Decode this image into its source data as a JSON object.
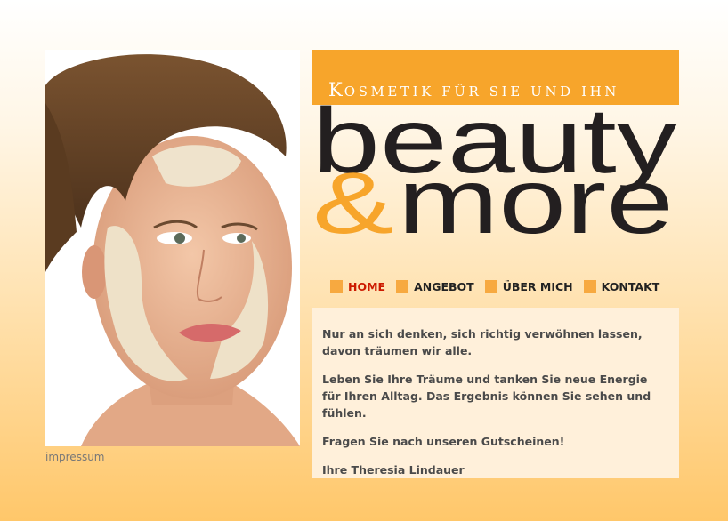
{
  "tagline": {
    "first_letter": "K",
    "rest": "OSMETIK FÜR SIE UND IHN"
  },
  "logo": {
    "line1": "beauty",
    "ampersand": "&",
    "line2": "more"
  },
  "nav": {
    "items": [
      {
        "label": "HOME",
        "active": true
      },
      {
        "label": "ANGEBOT",
        "active": false
      },
      {
        "label": "ÜBER MICH",
        "active": false
      },
      {
        "label": "KONTAKT",
        "active": false
      }
    ]
  },
  "content": {
    "paragraphs": [
      "Nur an sich denken, sich richtig verwöhnen lassen, davon träumen wir alle.",
      "Leben Sie Ihre Träume und tanken Sie neue Energie für Ihren Alltag. Das Ergebnis können Sie sehen und fühlen.",
      "Fragen Sie nach unseren Gutscheinen!",
      "Ihre Theresia Lindauer"
    ]
  },
  "footer": {
    "impressum": "impressum"
  },
  "colors": {
    "accent": "#f7a52b",
    "active_nav": "#cc1a00",
    "content_bg": "#fff0da",
    "text": "#4a4a4a"
  }
}
